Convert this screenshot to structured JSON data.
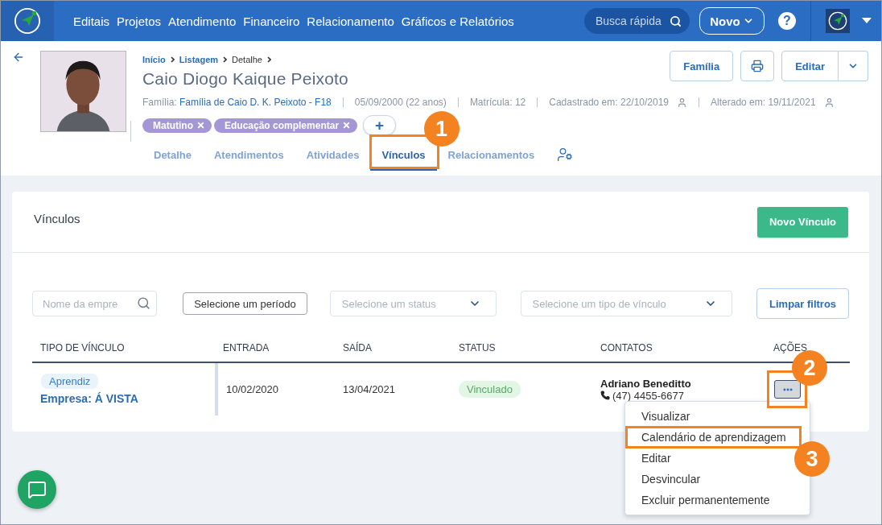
{
  "nav": {
    "items": [
      "Editais",
      "Projetos",
      "Atendimento",
      "Financeiro",
      "Relacionamento",
      "Gráficos e Relatórios"
    ],
    "search_placeholder": "Busca rápida",
    "new_button": "Novo",
    "help": "?"
  },
  "profile": {
    "photo": {
      "kind": "picture"
    },
    "breadcrumb": [
      {
        "label": "Início",
        "link": true
      },
      {
        "label": "Listagem",
        "link": true
      },
      {
        "label": "Detalhe",
        "link": false
      }
    ],
    "name": "Caio Diogo Kaique Peixoto",
    "meta": [
      {
        "kind": "family",
        "label": "Família:",
        "value": "Família de Caio D. K. Peixoto - F18"
      },
      {
        "kind": "text",
        "text": "05/09/2000 (22 anos)"
      },
      {
        "kind": "text",
        "text": "Matrícula: 12"
      },
      {
        "kind": "user",
        "text": "Cadastrado em: 22/10/2019"
      },
      {
        "kind": "user",
        "text": "Alterado em: 19/11/2021"
      }
    ],
    "tags": [
      "Matutino",
      "Educação complementar"
    ],
    "add_tag": "+",
    "actions": {
      "family": "Família",
      "edit": "Editar"
    }
  },
  "tabs": [
    {
      "label": "Detalhe",
      "selected": false
    },
    {
      "label": "Atendimentos",
      "selected": false
    },
    {
      "label": "Atividades",
      "selected": false
    },
    {
      "label": "Vínculos",
      "selected": true,
      "callout": "1"
    },
    {
      "label": "Relacionamentos",
      "selected": false
    }
  ],
  "section": {
    "title": "Vínculos",
    "new_button": "Novo Vínculo"
  },
  "filters": {
    "company_placeholder": "Nome da empre",
    "period": "Selecione um período",
    "status_placeholder": "Selecione um status",
    "type_placeholder": "Selecione um tipo de vínculo",
    "clear": "Limpar filtros"
  },
  "table": {
    "columns": [
      "TIPO DE VÍNCULO",
      "ENTRADA",
      "SAÍDA",
      "STATUS",
      "CONTATOS",
      "AÇÕES"
    ],
    "rows": [
      {
        "type_tag": "Aprendiz",
        "company": "Empresa: Á VISTA",
        "entry": "10/02/2020",
        "exit": "13/04/2021",
        "status": "Vinculado",
        "contact_name": "Adriano Beneditto",
        "contact_phone": "(47) 4455-6677",
        "actions_callout": "2"
      }
    ]
  },
  "menu": {
    "items": [
      {
        "label": "Visualizar"
      },
      {
        "label": "Calendário de aprendizagem",
        "callout": "3"
      },
      {
        "label": "Editar"
      },
      {
        "label": "Desvincular"
      },
      {
        "label": "Excluir permanentemente"
      }
    ]
  }
}
